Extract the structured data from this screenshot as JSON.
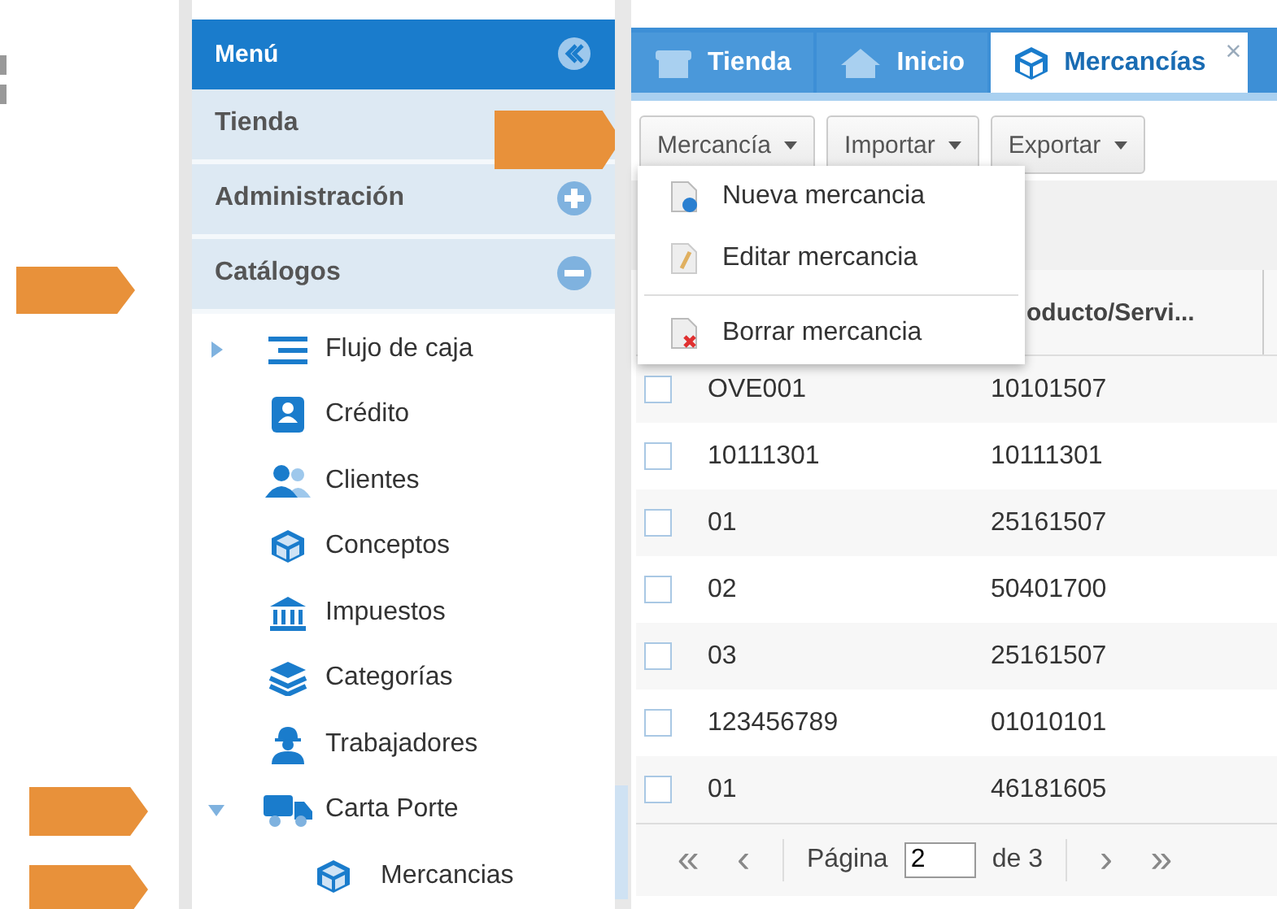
{
  "sidebar": {
    "title": "Menú",
    "sections": [
      {
        "label": "Tienda"
      },
      {
        "label": "Administración",
        "expanded": false
      },
      {
        "label": "Catálogos",
        "expanded": true
      }
    ],
    "tree": [
      {
        "label": "Flujo de caja",
        "kind": "folder",
        "expanded": false
      },
      {
        "label": "Crédito",
        "kind": "leaf"
      },
      {
        "label": "Clientes",
        "kind": "leaf"
      },
      {
        "label": "Conceptos",
        "kind": "leaf"
      },
      {
        "label": "Impuestos",
        "kind": "leaf"
      },
      {
        "label": "Categorías",
        "kind": "leaf"
      },
      {
        "label": "Trabajadores",
        "kind": "leaf"
      },
      {
        "label": "Carta Porte",
        "kind": "folder",
        "expanded": true,
        "children": [
          {
            "label": "Mercancias",
            "kind": "leaf"
          }
        ]
      }
    ]
  },
  "tabs": [
    {
      "label": "Tienda",
      "selected": false
    },
    {
      "label": "Inicio",
      "selected": false
    },
    {
      "label": "Mercancías",
      "selected": true,
      "close": "×"
    }
  ],
  "toolbar": [
    "Mercancía",
    "Importar",
    "Exportar"
  ],
  "menu": [
    "Nueva mercancia",
    "Editar mercancia",
    "Borrar mercancia"
  ],
  "table": {
    "columns": [
      "",
      "oducto/Servi..."
    ],
    "rows": [
      {
        "checked": false,
        "cells": [
          "OVE001",
          "10101507"
        ]
      },
      {
        "checked": false,
        "cells": [
          "10111301",
          "10111301"
        ]
      },
      {
        "checked": false,
        "cells": [
          "01",
          "25161507"
        ]
      },
      {
        "checked": false,
        "cells": [
          "02",
          "50401700"
        ]
      },
      {
        "checked": false,
        "cells": [
          "03",
          "25161507"
        ]
      },
      {
        "checked": false,
        "cells": [
          "123456789",
          "01010101"
        ]
      },
      {
        "checked": false,
        "cells": [
          "01",
          "46181605"
        ]
      }
    ]
  },
  "pager": {
    "first": "«",
    "previous": "‹",
    "label": "Página",
    "page": "2",
    "of": "de 3",
    "next": "›",
    "last": "»"
  }
}
